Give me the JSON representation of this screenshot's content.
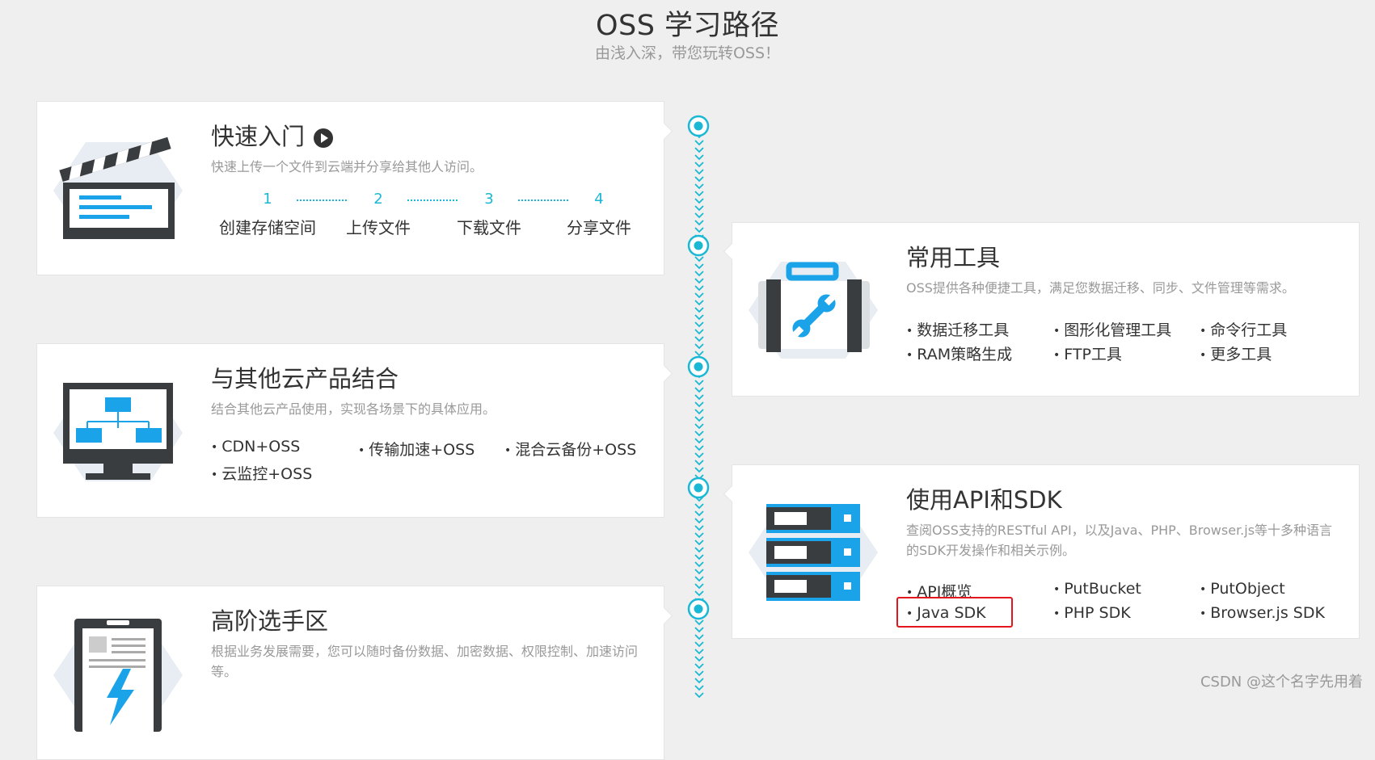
{
  "page": {
    "title": "OSS 学习路径",
    "subtitle": "由浅入深，带您玩转OSS！"
  },
  "cards": {
    "quick_start": {
      "title": "快速入门",
      "description": "快速上传一个文件到云端并分享给其他人访问。",
      "icon": "clapperboard-icon",
      "steps": [
        {
          "num": "1",
          "label": "创建存储空间"
        },
        {
          "num": "2",
          "label": "上传文件"
        },
        {
          "num": "3",
          "label": "下载文件"
        },
        {
          "num": "4",
          "label": "分享文件"
        }
      ]
    },
    "common_tools": {
      "title": "常用工具",
      "description": "OSS提供各种便捷工具，满足您数据迁移、同步、文件管理等需求。",
      "icon": "toolbox-wrench-icon",
      "links": [
        "数据迁移工具",
        "图形化管理工具",
        "命令行工具",
        "RAM策略生成",
        "FTP工具",
        "更多工具"
      ]
    },
    "integration": {
      "title": "与其他云产品结合",
      "description": "结合其他云产品使用，实现各场景下的具体应用。",
      "icon": "monitor-diagram-icon",
      "links": [
        "CDN+OSS",
        "传输加速+OSS",
        "混合云备份+OSS",
        "云监控+OSS"
      ]
    },
    "api_sdk": {
      "title": "使用API和SDK",
      "description_line1": "查阅OSS支持的RESTful API，以及Java、PHP、Browser.js等十多种语言",
      "description_line2": "的SDK开发操作和相关示例。",
      "icon": "server-rack-icon",
      "links": [
        "API概览",
        "PutBucket",
        "PutObject",
        "Java SDK",
        "PHP SDK",
        "Browser.js SDK"
      ]
    },
    "advanced": {
      "title": "高阶选手区",
      "description_line1": "根据业务发展需要，您可以随时备份数据、加密数据、权限控制、加速访问",
      "description_line2": "等。",
      "icon": "document-lightning-icon"
    }
  },
  "colors": {
    "accent": "#1ab8d4",
    "icon_dark": "#3a3d40",
    "icon_blue": "#1aa3e8",
    "highlight": "#e3161e",
    "hexagon": "#e7edf2"
  },
  "watermark": "CSDN @这个名字先用着"
}
